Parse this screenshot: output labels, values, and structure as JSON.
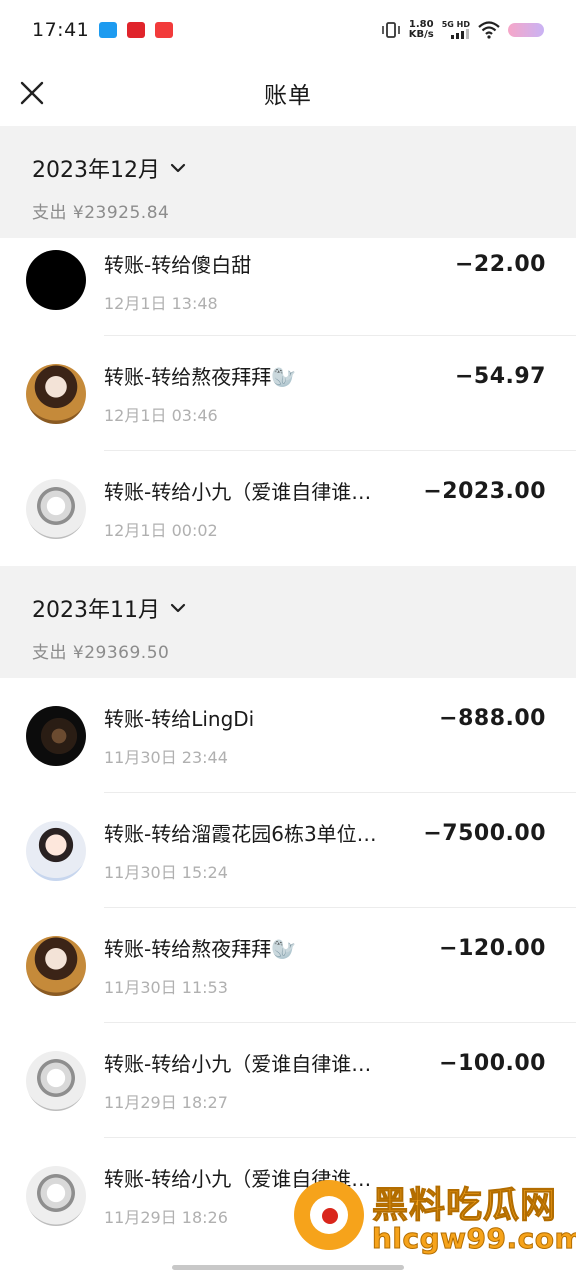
{
  "status_bar": {
    "time": "17:41",
    "net_speed_value": "1.80",
    "net_speed_unit": "KB/s",
    "signal_label": "5G HD"
  },
  "header": {
    "title": "账单"
  },
  "sections": [
    {
      "month": "2023年12月",
      "total": "支出 ¥23925.84",
      "items": [
        {
          "title": "转账-转给傻白甜",
          "time": "12月1日 13:48",
          "amount": "−22.00",
          "avatar": "av-black"
        },
        {
          "title": "转账-转给熬夜拜拜🦭",
          "time": "12月1日 03:46",
          "amount": "−54.97",
          "avatar": "av-girl1"
        },
        {
          "title": "转账-转给小九（爱谁自律谁…",
          "time": "12月1日 00:02",
          "amount": "−2023.00",
          "avatar": "av-sketch"
        }
      ]
    },
    {
      "month": "2023年11月",
      "total": "支出 ¥29369.50",
      "items": [
        {
          "title": "转账-转给LingDi",
          "time": "11月30日 23:44",
          "amount": "−888.00",
          "avatar": "av-dark"
        },
        {
          "title": "转账-转给溜霞花园6栋3单位…",
          "time": "11月30日 15:24",
          "amount": "−7500.00",
          "avatar": "av-girl2"
        },
        {
          "title": "转账-转给熬夜拜拜🦭",
          "time": "11月30日 11:53",
          "amount": "−120.00",
          "avatar": "av-girl1"
        },
        {
          "title": "转账-转给小九（爱谁自律谁…",
          "time": "11月29日 18:27",
          "amount": "−100.00",
          "avatar": "av-sketch"
        },
        {
          "title": "转账-转给小九（爱谁自律谁…",
          "time": "11月29日 18:26",
          "amount": "",
          "avatar": "av-sketch"
        }
      ]
    }
  ],
  "watermark": {
    "cn_text": "黑料吃瓜网",
    "url": "hlcgw99.com"
  },
  "colors": {
    "section_bg": "#f2f2f2",
    "muted_text": "#8c8c8c",
    "watermark_orange": "#f6a31b"
  }
}
